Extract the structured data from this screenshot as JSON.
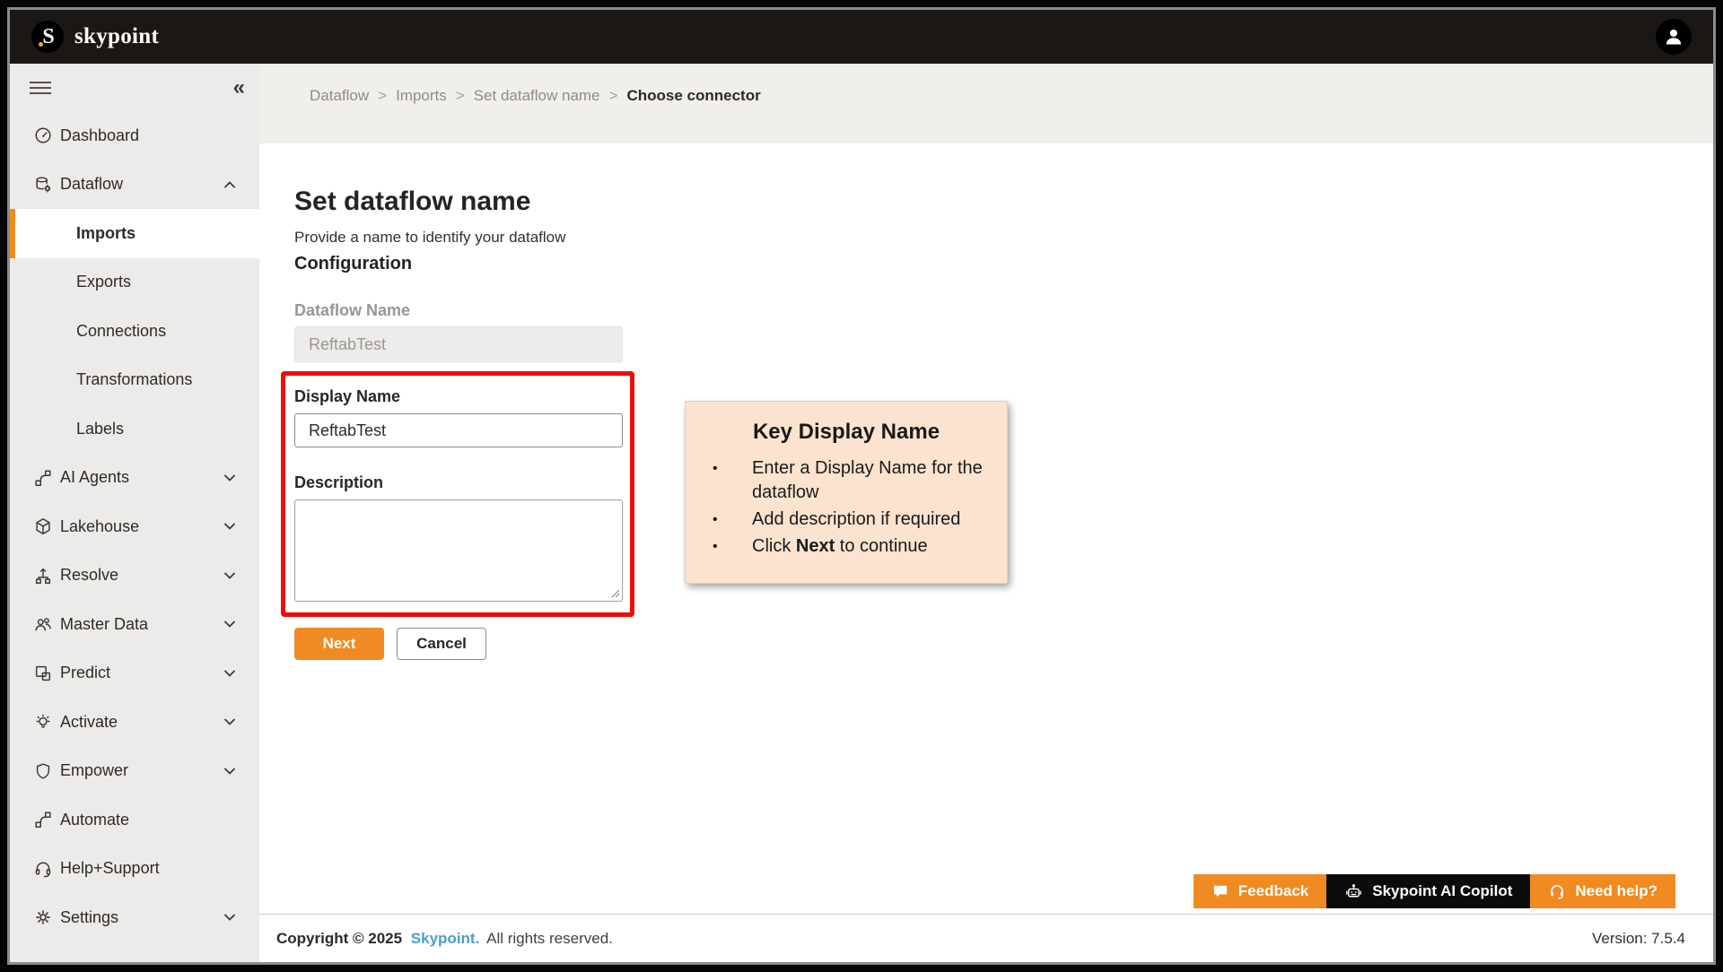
{
  "colors": {
    "accent_orange": "#EF8B22",
    "header_bg": "#1B1714",
    "sidebar_bg": "#EDEBE9",
    "highlight_red": "#EE0D0D",
    "callout_bg": "#FBE3CF",
    "link_blue": "#4A9ED2"
  },
  "header": {
    "logo_letter": "S",
    "brand": "skypoint"
  },
  "sidebar": {
    "items": [
      {
        "label": "Dashboard",
        "icon": "gauge-icon"
      },
      {
        "label": "Dataflow",
        "icon": "dataflow-icon",
        "chevron": "up"
      },
      {
        "label": "Imports",
        "sub": true,
        "active": true
      },
      {
        "label": "Exports",
        "sub": true
      },
      {
        "label": "Connections",
        "sub": true
      },
      {
        "label": "Transformations",
        "sub": true
      },
      {
        "label": "Labels",
        "sub": true
      },
      {
        "label": "AI Agents",
        "icon": "flow-icon",
        "chevron": "down"
      },
      {
        "label": "Lakehouse",
        "icon": "cube-icon",
        "chevron": "down"
      },
      {
        "label": "Resolve",
        "icon": "hierarchy-icon",
        "chevron": "down"
      },
      {
        "label": "Master Data",
        "icon": "people-icon",
        "chevron": "down"
      },
      {
        "label": "Predict",
        "icon": "squares-icon",
        "chevron": "down"
      },
      {
        "label": "Activate",
        "icon": "bulb-icon",
        "chevron": "down"
      },
      {
        "label": "Empower",
        "icon": "shield-icon",
        "chevron": "down"
      },
      {
        "label": "Automate",
        "icon": "flow-icon"
      },
      {
        "label": "Help+Support",
        "icon": "headset-icon"
      },
      {
        "label": "Settings",
        "icon": "gear-icon",
        "chevron": "down"
      }
    ]
  },
  "breadcrumb": {
    "crumbs": [
      "Dataflow",
      "Imports",
      "Set dataflow name"
    ],
    "current": "Choose connector",
    "separator": ">"
  },
  "page": {
    "title": "Set dataflow name",
    "subtitle": "Provide a name to identify your dataflow",
    "section_heading": "Configuration"
  },
  "form": {
    "dataflow_name": {
      "label": "Dataflow Name",
      "value": "ReftabTest"
    },
    "display_name": {
      "label": "Display Name",
      "value": "ReftabTest"
    },
    "description": {
      "label": "Description",
      "value": ""
    },
    "next_label": "Next",
    "cancel_label": "Cancel"
  },
  "callout": {
    "title": "Key Display Name",
    "marker": "•",
    "bullets": [
      {
        "pre": "Enter a Display Name for the dataflow",
        "bold": "",
        "post": ""
      },
      {
        "pre": "Add description if required",
        "bold": "",
        "post": ""
      },
      {
        "pre": "Click ",
        "bold": "Next",
        "post": " to continue"
      }
    ]
  },
  "support_bar": {
    "feedback": "Feedback",
    "copilot": "Skypoint AI Copilot",
    "help": "Need help?"
  },
  "footer": {
    "copyright_prefix": "Copyright © 2025",
    "brand_link": "Skypoint.",
    "copyright_suffix": "All rights reserved.",
    "version": "Version: 7.5.4"
  }
}
